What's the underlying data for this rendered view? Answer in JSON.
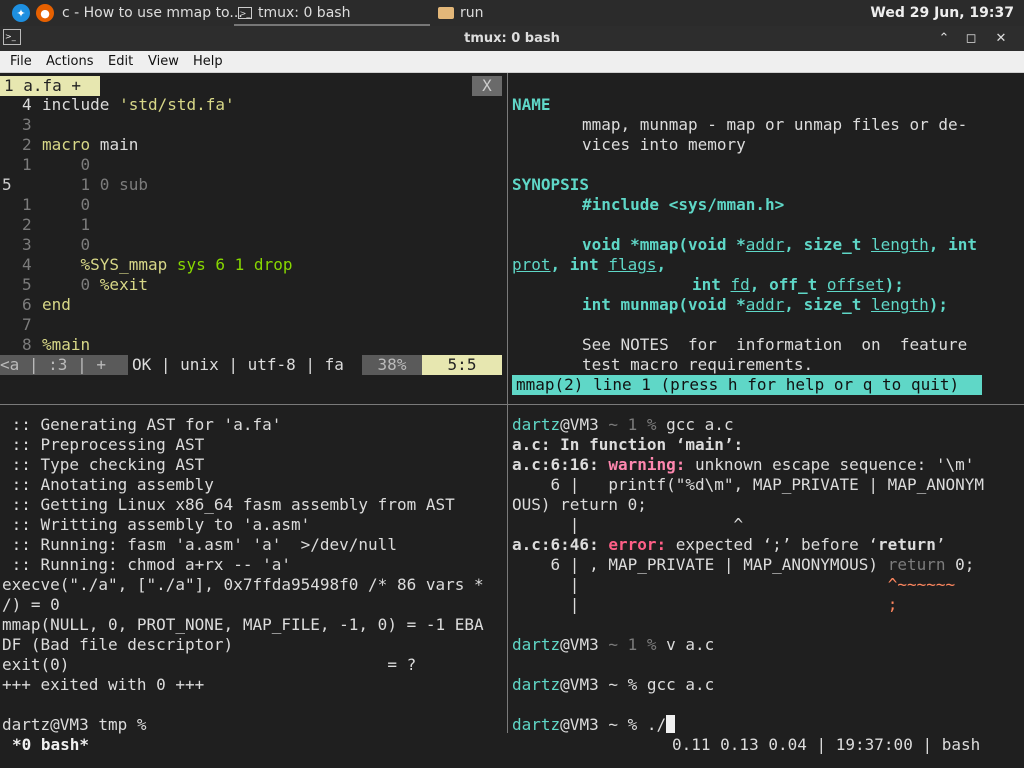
{
  "taskbar": {
    "tasks": [
      {
        "label": "c - How to use mmap to..."
      },
      {
        "label": "tmux: 0 bash"
      },
      {
        "label": "run"
      }
    ],
    "clock": "Wed 29 Jun, 19:37"
  },
  "window": {
    "title": "tmux: 0 bash",
    "buttons": {
      "minimize": "⌃",
      "maximize": "◻",
      "close": "✕"
    }
  },
  "menu": [
    "File",
    "Actions",
    "Edit",
    "View",
    "Help"
  ],
  "editor": {
    "tab_label": "1 a.fa +",
    "close_label": "X",
    "lines": [
      {
        "num": "4",
        "code": "include 'std/std.fa'"
      },
      {
        "num": "3",
        "code": ""
      },
      {
        "num": "2",
        "code": "macro main"
      },
      {
        "num": "1",
        "code": "    0"
      },
      {
        "num": "5",
        "code": "    1 0 sub"
      },
      {
        "num": "1",
        "code": "    0"
      },
      {
        "num": "2",
        "code": "    1"
      },
      {
        "num": "3",
        "code": "    0"
      },
      {
        "num": "4",
        "code": "    %SYS_mmap sys 6 1 drop"
      },
      {
        "num": "5",
        "code": "    0 %exit"
      },
      {
        "num": "6",
        "code": "end"
      },
      {
        "num": "7",
        "code": ""
      },
      {
        "num": "8",
        "code": "%main"
      }
    ],
    "status": {
      "mode": "<a",
      "pos": ":3",
      "plus": "+",
      "info": "OK | unix | utf-8 | fa",
      "percent": "38%",
      "cursor": "5:5"
    }
  },
  "manpage": {
    "name_header": "NAME",
    "name_line1": "mmap, munmap - map or unmap files or de-",
    "name_line2": "vices into memory",
    "synopsis_header": "SYNOPSIS",
    "include": "#include <sys/mman.h>",
    "proto1": "void *mmap(void *addr, size_t length, int",
    "proto2": "prot, int flags,",
    "proto3": "int fd, off_t offset);",
    "proto4": "int munmap(void *addr, size_t length);",
    "notes1": "See NOTES  for  information  on  feature",
    "notes2": "test macro requirements.",
    "status": "mmap(2) line 1 (press h for help or q to quit)"
  },
  "build_log": {
    "lines": [
      " :: Generating AST for 'a.fa'",
      " :: Preprocessing AST",
      " :: Type checking AST",
      " :: Anotating assembly",
      " :: Getting Linux x86_64 fasm assembly from AST",
      " :: Writting assembly to 'a.asm'",
      " :: Running: fasm 'a.asm' 'a'  >/dev/null",
      " :: Running: chmod a+rx -- 'a'",
      "execve(\"./a\", [\"./a\"], 0x7ffda95498f0 /* 86 vars *",
      "/) = 0",
      "mmap(NULL, 0, PROT_NONE, MAP_FILE, -1, 0) = -1 EBA",
      "DF (Bad file descriptor)",
      "exit(0)                                 = ?",
      "+++ exited with 0 +++",
      "",
      "dartz@VM3 tmp %"
    ]
  },
  "shell": {
    "user": "dartz",
    "host": "@VM3",
    "prompt1_mid": " ~ 1 % ",
    "cmd1": "gcc a.c",
    "err_func": "a.c: In function ‘main’:",
    "err_loc1": "a.c:6:16: ",
    "warning_label": "warning:",
    "warning_msg": " unknown escape sequence: '\\m'",
    "src1": "    6 |   printf(\"%d\\m\", MAP_PRIVATE | MAP_ANONYM",
    "src1b": "OUS) return 0;",
    "caret1": "      |                ^",
    "err_loc2": "a.c:6:46: ",
    "error_label": "error:",
    "error_msg_a": " expected ‘;’ before ‘",
    "error_kw": "return",
    "error_msg_b": "’",
    "src2a": "    6 | , MAP_PRIVATE | MAP_ANONYMOUS) ",
    "src2b": "return",
    "src2c": " 0;",
    "caret2a": "      |                                ",
    "caret2b": "^~~~~~~",
    "caret3a": "      |                                ",
    "caret3b": ";",
    "prompt2_mid": " ~ 1 % ",
    "cmd2": "v a.c",
    "prompt3_mid": " ~ % ",
    "cmd3": "gcc a.c",
    "prompt4_mid": " ~ % ",
    "cmd4": "./"
  },
  "tmux_status": {
    "window": "*0 bash*",
    "right": "0.11 0.13 0.04 | 19:37:00 | bash"
  },
  "colors": {
    "teal": "#5fd7c7",
    "editor_tab": "#e7e7b0",
    "warning": "#ff87af",
    "error": "#ff5f87"
  }
}
